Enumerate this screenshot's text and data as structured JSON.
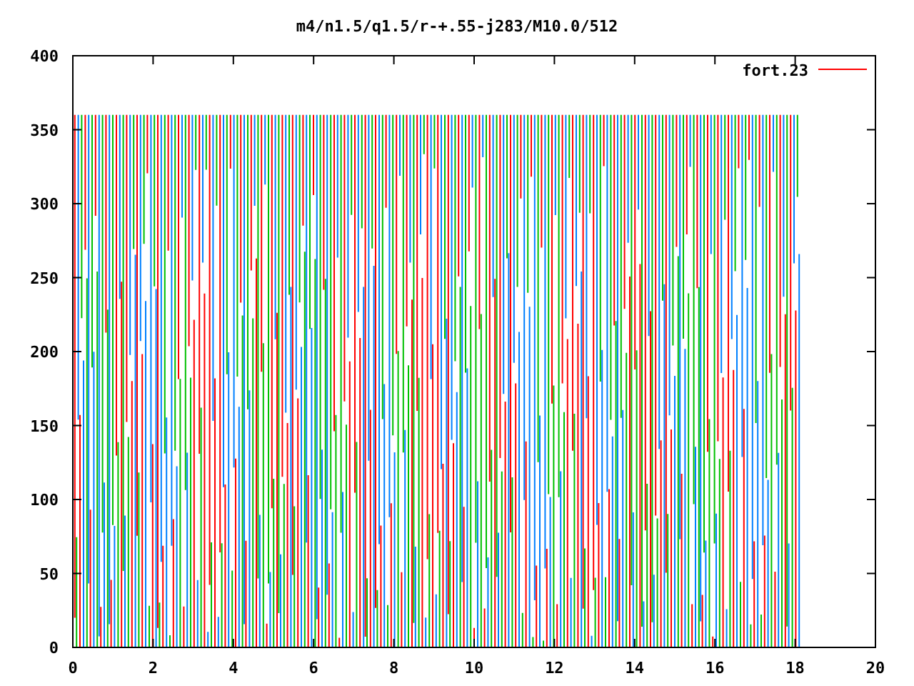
{
  "plot": {
    "title": "m4/n1.5/q1.5/r-+.55-j283/M10.0/512",
    "x_axis": {
      "ticks": [
        "0",
        "2",
        "4",
        "6",
        "8",
        "10",
        "12",
        "14",
        "16",
        "18",
        "20"
      ]
    },
    "y_axis": {
      "ticks": [
        "400",
        "350",
        "300",
        "250",
        "200",
        "150",
        "100",
        "50",
        "0"
      ]
    },
    "legend": {
      "label": "fort.23"
    }
  }
}
